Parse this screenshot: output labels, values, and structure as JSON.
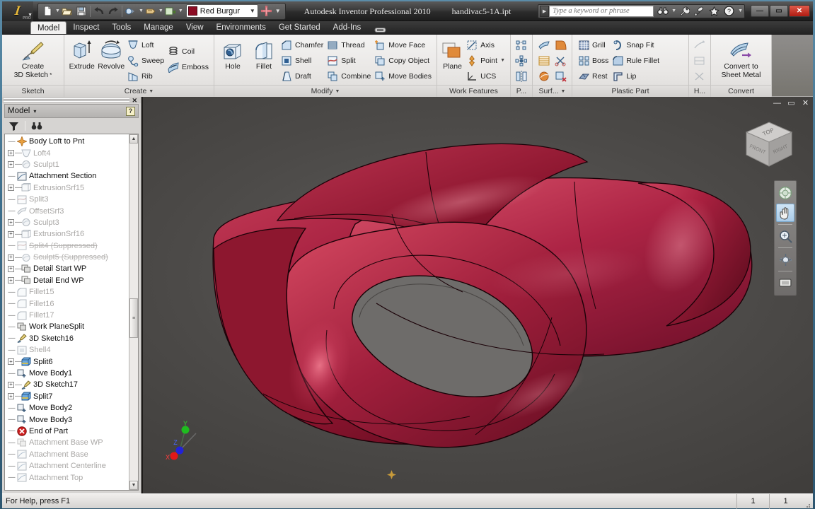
{
  "titlebar": {
    "app_title": "Autodesk Inventor Professional 2010",
    "document_name": "handivac5-1A.ipt",
    "logo_text": "I",
    "logo_sub": "PRO",
    "color_style": {
      "name": "Red Burgur",
      "swatch": "#8c0d24"
    },
    "search": {
      "placeholder": "Type a keyword or phrase",
      "value": ""
    },
    "quick_access": [
      {
        "name": "new-document",
        "label": "New"
      },
      {
        "name": "open-document",
        "label": "Open"
      },
      {
        "name": "save-document",
        "label": "Save"
      },
      {
        "name": "undo",
        "label": "Undo"
      },
      {
        "name": "redo",
        "label": "Redo"
      },
      {
        "name": "select-filter",
        "label": "Select"
      },
      {
        "name": "return",
        "label": "Return"
      },
      {
        "name": "update",
        "label": "Update"
      }
    ],
    "help_icons": [
      {
        "name": "binoculars-icon",
        "label": "Search Help"
      },
      {
        "name": "wrench-icon",
        "label": "Options"
      },
      {
        "name": "satellite-icon",
        "label": "Subscription Center"
      },
      {
        "name": "star-icon",
        "label": "Favorites"
      },
      {
        "name": "question-icon",
        "label": "Help"
      }
    ],
    "window_controls": {
      "minimize": "—",
      "maximize": "▭",
      "close": "✕"
    }
  },
  "tabs": [
    {
      "label": "Model",
      "active": true
    },
    {
      "label": "Inspect",
      "active": false
    },
    {
      "label": "Tools",
      "active": false
    },
    {
      "label": "Manage",
      "active": false
    },
    {
      "label": "View",
      "active": false
    },
    {
      "label": "Environments",
      "active": false
    },
    {
      "label": "Get Started",
      "active": false
    },
    {
      "label": "Add-Ins",
      "active": false
    }
  ],
  "ribbon": {
    "panels": [
      {
        "label": "Sketch",
        "has_caret": false,
        "big_buttons": [
          {
            "name": "create-3d-sketch-button",
            "line1": "Create",
            "line2": "3D Sketch",
            "icon": "sketch-pencil-icon"
          }
        ],
        "small_groups": []
      },
      {
        "label": "Create",
        "has_caret": true,
        "big_buttons": [
          {
            "name": "extrude-button",
            "line1": "Extrude",
            "line2": "",
            "icon": "extrude-icon"
          },
          {
            "name": "revolve-button",
            "line1": "Revolve",
            "line2": "",
            "icon": "revolve-icon"
          }
        ],
        "small_groups": [
          [
            {
              "name": "loft-button",
              "label": "Loft",
              "icon": "loft-icon"
            },
            {
              "name": "sweep-button",
              "label": "Sweep",
              "icon": "sweep-icon"
            },
            {
              "name": "rib-button",
              "label": "Rib",
              "icon": "rib-icon"
            }
          ],
          [
            {
              "name": "coil-button",
              "label": "Coil",
              "icon": "coil-icon"
            },
            {
              "name": "emboss-button",
              "label": "Emboss",
              "icon": "emboss-icon"
            }
          ]
        ]
      },
      {
        "label": "Modify",
        "has_caret": true,
        "big_buttons": [
          {
            "name": "hole-button",
            "line1": "Hole",
            "line2": "",
            "icon": "hole-icon"
          },
          {
            "name": "fillet-button",
            "line1": "Fillet",
            "line2": "",
            "icon": "fillet-icon"
          }
        ],
        "small_groups": [
          [
            {
              "name": "chamfer-button",
              "label": "Chamfer",
              "icon": "chamfer-icon"
            },
            {
              "name": "shell-button",
              "label": "Shell",
              "icon": "shell-icon"
            },
            {
              "name": "draft-button",
              "label": "Draft",
              "icon": "draft-icon"
            }
          ],
          [
            {
              "name": "thread-button",
              "label": "Thread",
              "icon": "thread-icon"
            },
            {
              "name": "split-button",
              "label": "Split",
              "icon": "split-icon"
            },
            {
              "name": "combine-button",
              "label": "Combine",
              "icon": "combine-icon"
            }
          ],
          [
            {
              "name": "move-face-button",
              "label": "Move Face",
              "icon": "move-face-icon"
            },
            {
              "name": "copy-object-button",
              "label": "Copy Object",
              "icon": "copy-object-icon"
            },
            {
              "name": "move-bodies-button",
              "label": "Move Bodies",
              "icon": "move-bodies-icon"
            }
          ]
        ]
      },
      {
        "label": "Work Features",
        "has_caret": false,
        "big_buttons": [
          {
            "name": "plane-button",
            "line1": "Plane",
            "line2": "",
            "icon": "work-plane-icon"
          }
        ],
        "small_groups": [
          [
            {
              "name": "axis-button",
              "label": "Axis",
              "icon": "work-axis-icon",
              "caret": false
            },
            {
              "name": "point-button",
              "label": "Point",
              "icon": "work-point-icon",
              "caret": true
            },
            {
              "name": "ucs-button",
              "label": "UCS",
              "icon": "ucs-icon",
              "caret": false
            }
          ]
        ]
      },
      {
        "label": "P...",
        "has_caret": false,
        "icon_grid": [
          {
            "name": "pattern-rectangular-icon"
          },
          {
            "name": "pattern-circular-icon"
          },
          {
            "name": "mirror-icon"
          }
        ]
      },
      {
        "label": "Surf...",
        "has_caret": true,
        "icon_grid": [
          {
            "name": "thicken-offset-icon"
          },
          {
            "name": "stitch-icon"
          },
          {
            "name": "sculpt-icon"
          },
          {
            "name": "ruled-surface-icon"
          },
          {
            "name": "trim-surface-icon"
          },
          {
            "name": "delete-face-icon"
          }
        ]
      },
      {
        "label": "Plastic Part",
        "has_caret": false,
        "small_groups": [
          [
            {
              "name": "grill-button",
              "label": "Grill",
              "icon": "grill-icon"
            },
            {
              "name": "boss-button",
              "label": "Boss",
              "icon": "boss-icon"
            },
            {
              "name": "rest-button",
              "label": "Rest",
              "icon": "rest-icon"
            }
          ],
          [
            {
              "name": "snap-fit-button",
              "label": "Snap Fit",
              "icon": "snap-fit-icon"
            },
            {
              "name": "rule-fillet-button",
              "label": "Rule Fillet",
              "icon": "rule-fillet-icon"
            },
            {
              "name": "lip-button",
              "label": "Lip",
              "icon": "lip-icon"
            }
          ]
        ]
      },
      {
        "label": "H...",
        "has_caret": false,
        "icon_grid_disabled": [
          {
            "name": "harness-wire-icon"
          },
          {
            "name": "harness-route-icon"
          },
          {
            "name": "harness-segment-icon"
          }
        ]
      },
      {
        "label": "Convert",
        "has_caret": false,
        "big_buttons": [
          {
            "name": "convert-to-sheet-metal-button",
            "line1": "Convert to",
            "line2": "Sheet Metal",
            "icon": "sheet-metal-icon"
          }
        ]
      }
    ]
  },
  "browser": {
    "title": "Model",
    "caret": "▾",
    "help_badge": "?",
    "tools": [
      {
        "name": "filter-icon",
        "label": "Filter"
      },
      {
        "name": "find-binoculars-icon",
        "label": "Find"
      }
    ],
    "tree": [
      {
        "label": "Body Loft to Pnt",
        "icon": "origin-point-icon",
        "expand": "none",
        "state": "normal"
      },
      {
        "label": "Loft4",
        "icon": "loft-feature-icon",
        "expand": "plus",
        "state": "gray"
      },
      {
        "label": "Sculpt1",
        "icon": "sculpt-feature-icon",
        "expand": "plus",
        "state": "gray"
      },
      {
        "label": "Attachment Section",
        "icon": "sketch-feature-icon",
        "expand": "none",
        "state": "normal"
      },
      {
        "label": "ExtrusionSrf15",
        "icon": "extrusion-srf-icon",
        "expand": "plus",
        "state": "gray"
      },
      {
        "label": "Split3",
        "icon": "split-feature-icon",
        "expand": "none",
        "state": "gray"
      },
      {
        "label": "OffsetSrf3",
        "icon": "offset-srf-icon",
        "expand": "none",
        "state": "gray"
      },
      {
        "label": "Sculpt3",
        "icon": "sculpt-feature-icon",
        "expand": "plus",
        "state": "gray"
      },
      {
        "label": "ExtrusionSrf16",
        "icon": "extrusion-srf-icon",
        "expand": "plus",
        "state": "gray"
      },
      {
        "label": "Split4 (Suppressed)",
        "icon": "split-feature-icon",
        "expand": "none",
        "state": "strike"
      },
      {
        "label": "Sculpt5 (Suppressed)",
        "icon": "sculpt-feature-icon",
        "expand": "plus",
        "state": "strike"
      },
      {
        "label": "Detail Start WP",
        "icon": "work-plane-tree-icon",
        "expand": "plus",
        "state": "normal"
      },
      {
        "label": "Detail End WP",
        "icon": "work-plane-tree-icon",
        "expand": "plus",
        "state": "normal"
      },
      {
        "label": "Fillet15",
        "icon": "fillet-feature-icon",
        "expand": "none",
        "state": "gray"
      },
      {
        "label": "Fillet16",
        "icon": "fillet-feature-icon",
        "expand": "none",
        "state": "gray"
      },
      {
        "label": "Fillet17",
        "icon": "fillet-feature-icon",
        "expand": "none",
        "state": "gray"
      },
      {
        "label": "Work PlaneSplit",
        "icon": "work-plane-tree-icon",
        "expand": "none",
        "state": "normal"
      },
      {
        "label": "3D Sketch16",
        "icon": "sketch3d-icon",
        "expand": "none",
        "state": "normal"
      },
      {
        "label": "Shell4",
        "icon": "shell-feature-icon",
        "expand": "none",
        "state": "gray"
      },
      {
        "label": "Split6",
        "icon": "split-color-icon",
        "expand": "plus",
        "state": "normal"
      },
      {
        "label": "Move Body1",
        "icon": "move-body-icon",
        "expand": "none",
        "state": "normal"
      },
      {
        "label": "3D Sketch17",
        "icon": "sketch3d-icon",
        "expand": "plus",
        "state": "normal"
      },
      {
        "label": "Split7",
        "icon": "split-color-icon",
        "expand": "plus",
        "state": "normal"
      },
      {
        "label": "Move Body2",
        "icon": "move-body-icon",
        "expand": "none",
        "state": "normal"
      },
      {
        "label": "Move Body3",
        "icon": "move-body-icon",
        "expand": "none",
        "state": "normal"
      },
      {
        "label": "End of Part",
        "icon": "end-of-part-icon",
        "expand": "none",
        "state": "normal"
      },
      {
        "label": "Attachment Base WP",
        "icon": "work-plane-tree-icon",
        "expand": "none",
        "state": "gray"
      },
      {
        "label": "Attachment Base",
        "icon": "sketch-feature-icon",
        "expand": "none",
        "state": "gray"
      },
      {
        "label": "Attachment Centerline",
        "icon": "sketch-feature-icon",
        "expand": "none",
        "state": "gray"
      },
      {
        "label": "Attachment Top",
        "icon": "sketch-feature-icon",
        "expand": "none",
        "state": "gray"
      }
    ]
  },
  "viewport": {
    "window_controls": {
      "minimize": "—",
      "restore": "▭",
      "close": "✕"
    },
    "viewcube": {
      "top": "TOP",
      "front": "FRONT",
      "right": "RIGHT"
    },
    "nav_tools": [
      {
        "name": "steering-wheel-icon",
        "label": "Full Navigation Wheel",
        "selected": false
      },
      {
        "name": "pan-hand-icon",
        "label": "Pan",
        "selected": true
      },
      {
        "name": "zoom-magnifier-icon",
        "label": "Zoom",
        "selected": false
      },
      {
        "name": "orbit-icon",
        "label": "Orbit",
        "selected": false
      },
      {
        "name": "look-at-icon",
        "label": "Look At",
        "selected": false
      }
    ],
    "axis_labels": {
      "x": "X",
      "y": "Y",
      "z": "Z"
    },
    "model_colors": {
      "body_light": "#d4536a",
      "body_mid": "#b22a46",
      "body_dark": "#7e0f28",
      "body_shadow": "#56081a",
      "cut_face": "#6f6d6b",
      "edge": "#1a0408"
    },
    "background_colors": {
      "top": "#5e5c5a",
      "bottom": "#3a3836"
    }
  },
  "statusbar": {
    "message": "For Help, press F1",
    "cells": [
      "1",
      "1"
    ]
  }
}
